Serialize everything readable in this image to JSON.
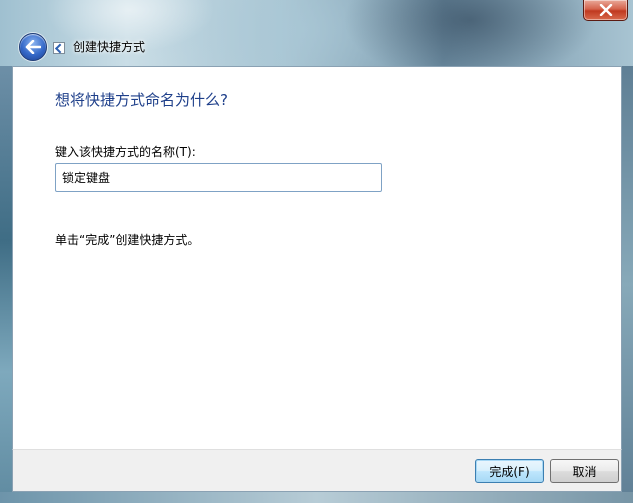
{
  "window": {
    "title": "创建快捷方式",
    "close_icon": "close-icon",
    "back_icon": "back-arrow-icon"
  },
  "page": {
    "heading": "想将快捷方式命名为什么?",
    "field_label": "键入该快捷方式的名称(T):",
    "name_value": "锁定键盘",
    "hint": "单击“完成”创建快捷方式。"
  },
  "footer": {
    "finish_label": "完成(F)",
    "cancel_label": "取消"
  },
  "colors": {
    "heading": "#1e3f8a",
    "close_button": "#c0391f",
    "default_button_border": "#3c7fb1"
  }
}
